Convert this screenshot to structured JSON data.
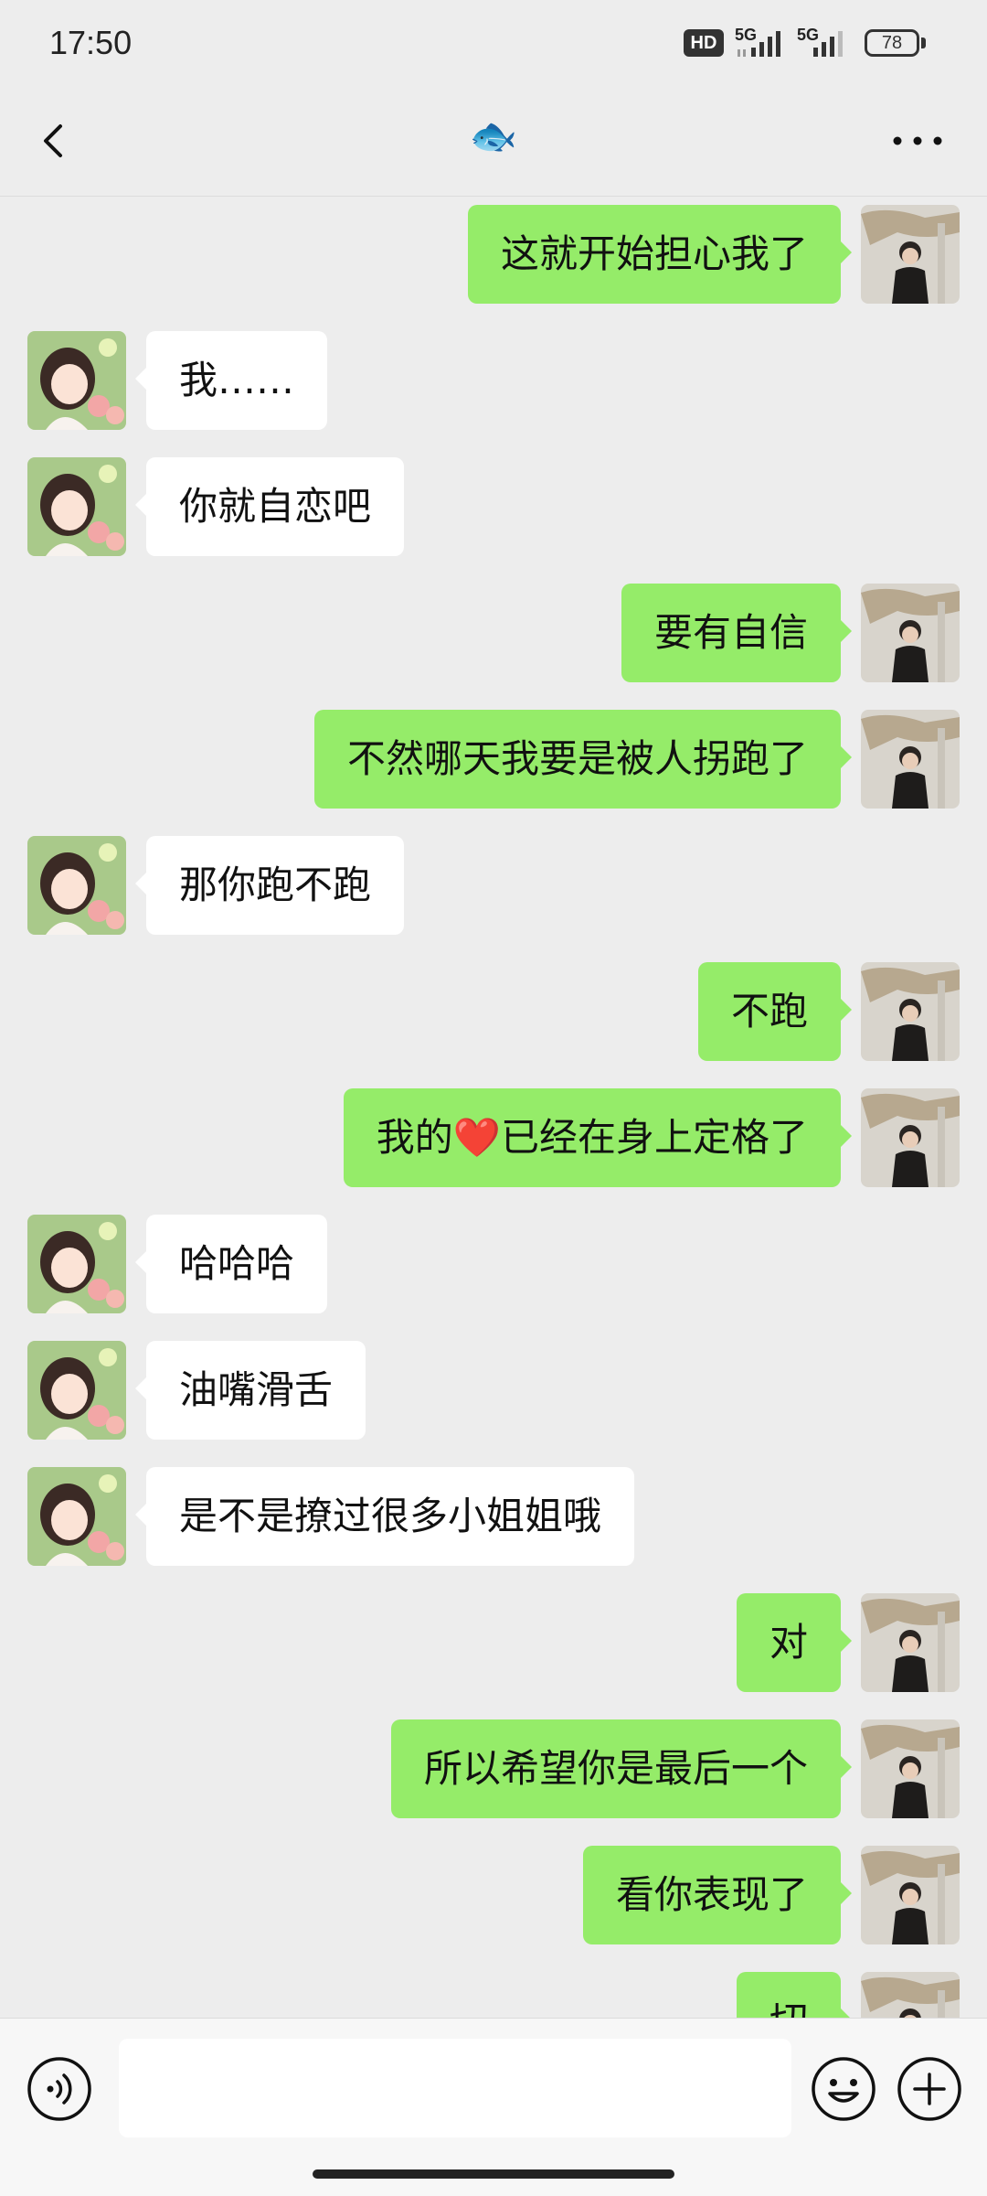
{
  "status_bar": {
    "time": "17:50",
    "hd": "HD",
    "network1": "5G",
    "network2": "5G",
    "battery": "78"
  },
  "header": {
    "title": "🐟"
  },
  "messages": [
    {
      "side": "right",
      "text": "这就开始担心我了"
    },
    {
      "side": "left",
      "text": "我……"
    },
    {
      "side": "left",
      "text": "你就自恋吧"
    },
    {
      "side": "right",
      "text": "要有自信"
    },
    {
      "side": "right",
      "text": "不然哪天我要是被人拐跑了"
    },
    {
      "side": "left",
      "text": "那你跑不跑"
    },
    {
      "side": "right",
      "text": "不跑"
    },
    {
      "side": "right",
      "text": "我的❤️已经在身上定格了"
    },
    {
      "side": "left",
      "text": "哈哈哈"
    },
    {
      "side": "left",
      "text": "油嘴滑舌"
    },
    {
      "side": "left",
      "text": "是不是撩过很多小姐姐哦"
    },
    {
      "side": "right",
      "text": "对"
    },
    {
      "side": "right",
      "text": "所以希望你是最后一个"
    },
    {
      "side": "right",
      "text": "看你表现了"
    },
    {
      "side": "right",
      "text": "切"
    }
  ],
  "input": {
    "value": "",
    "placeholder": ""
  },
  "icons": {
    "back": "chevron-left-icon",
    "more": "more-horizontal-icon",
    "voice": "voice-icon",
    "emoji": "emoji-icon",
    "plus": "plus-icon"
  },
  "colors": {
    "sent_bubble": "#95ec69",
    "received_bubble": "#ffffff",
    "background": "#ededed"
  }
}
